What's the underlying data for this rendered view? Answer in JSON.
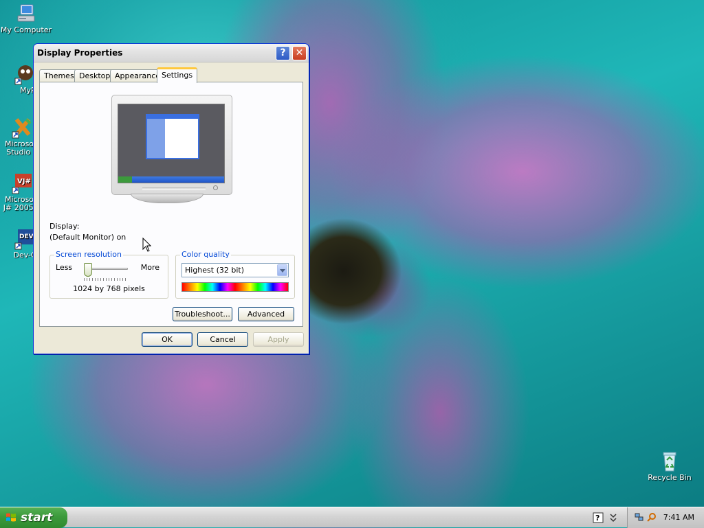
{
  "desktop": {
    "icons": [
      {
        "label": "My Computer"
      },
      {
        "label": "MyPal"
      },
      {
        "label": "Microsoft",
        "label2": "Studio 2"
      },
      {
        "label": "Microsoft",
        "label2": "J# 2005 E"
      },
      {
        "label": "Dev-C"
      },
      {
        "label": "Recycle Bin"
      }
    ]
  },
  "window": {
    "title": "Display Properties",
    "help_glyph": "?",
    "close_glyph": "✕",
    "tabs": [
      {
        "label": "Themes"
      },
      {
        "label": "Desktop"
      },
      {
        "label": "Appearance"
      },
      {
        "label": "Settings",
        "active": true
      }
    ],
    "settings": {
      "display_label": "Display:",
      "display_value": "(Default Monitor) on",
      "screen_resolution": {
        "legend": "Screen resolution",
        "less_label": "Less",
        "more_label": "More",
        "value": "1024 by 768 pixels",
        "slider_level": 0.1
      },
      "color_quality": {
        "legend": "Color quality",
        "selected": "Highest (32 bit)"
      },
      "troubleshoot_label": "Troubleshoot...",
      "advanced_label": "Advanced"
    },
    "buttons": {
      "ok": "OK",
      "cancel": "Cancel",
      "apply": "Apply"
    }
  },
  "taskbar": {
    "start_label": "start",
    "clock": "7:41 AM"
  },
  "colors": {
    "title_bar_border": "#0831d9",
    "start_green": "#3c9a3c",
    "legend_blue": "#0046d5",
    "tab_highlight": "#ffc83c"
  }
}
